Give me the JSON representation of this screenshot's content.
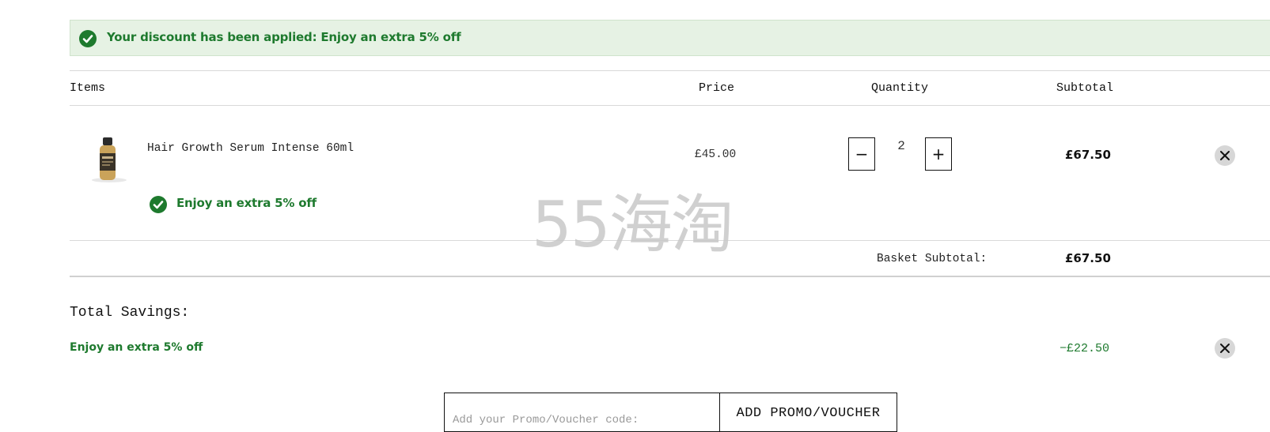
{
  "banner": {
    "message": "Your discount has been applied: Enjoy an extra 5% off"
  },
  "table": {
    "headers": {
      "items": "Items",
      "price": "Price",
      "quantity": "Quantity",
      "subtotal": "Subtotal"
    }
  },
  "item": {
    "name": "Hair Growth Serum Intense 60ml",
    "promo": "Enjoy an extra 5% off",
    "price": "£45.00",
    "quantity": "2",
    "decrement_label": "−",
    "increment_label": "+",
    "subtotal": "£67.50"
  },
  "basket": {
    "label": "Basket Subtotal:",
    "value": "£67.50"
  },
  "savings": {
    "title": "Total Savings:",
    "name": "Enjoy an extra 5% off",
    "amount": "−£22.50"
  },
  "promo": {
    "placeholder": "Add your Promo/Voucher code:",
    "button_label": "ADD PROMO/VOUCHER"
  },
  "watermark": "55海淘",
  "colors": {
    "success_green": "#1e7a2e",
    "banner_bg": "#e6f2e4",
    "remove_bg": "#d7d7d7"
  },
  "icons": {
    "check": "check-circle-icon",
    "remove": "close-icon"
  }
}
